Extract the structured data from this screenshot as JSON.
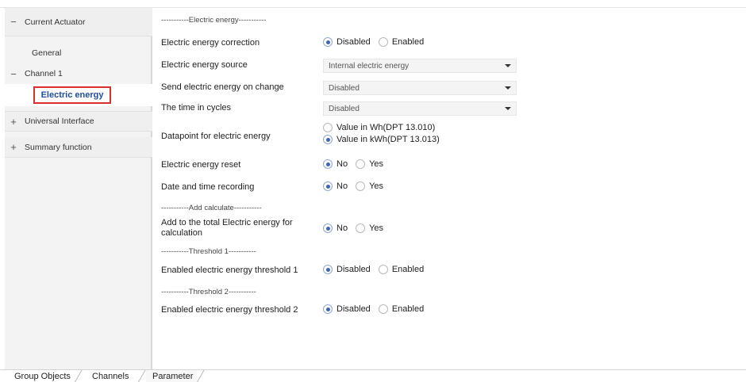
{
  "tree": {
    "items": [
      {
        "sign": "−",
        "label": "Current Actuator"
      },
      {
        "sign": "",
        "label": "General"
      },
      {
        "sign": "−",
        "label": "Channel 1"
      },
      {
        "sign": "",
        "label": "Electric energy"
      },
      {
        "sign": "+",
        "label": "Universal Interface"
      },
      {
        "sign": "+",
        "label": "Summary function"
      }
    ]
  },
  "params": {
    "sep_electric": "-----------Electric energy-----------",
    "correction": {
      "label": "Electric energy correction",
      "options": [
        "Disabled",
        "Enabled"
      ],
      "selected": "Disabled"
    },
    "source": {
      "label": "Electric energy source",
      "value": "Internal electric energy"
    },
    "send_on_change": {
      "label": "Send electric energy on change",
      "value": "Disabled"
    },
    "time_in_cycles": {
      "label": "The time in cycles",
      "value": "Disabled"
    },
    "datapoint": {
      "label": "Datapoint for electric energy",
      "options": [
        "Value in Wh(DPT 13.010)",
        "Value in kWh(DPT 13.013)"
      ],
      "selected": "Value in kWh(DPT 13.013)"
    },
    "reset": {
      "label": "Electric energy reset",
      "options": [
        "No",
        "Yes"
      ],
      "selected": "No"
    },
    "date_time": {
      "label": "Date and time recording",
      "options": [
        "No",
        "Yes"
      ],
      "selected": "No"
    },
    "sep_add": "-----------Add calculate-----------",
    "add_total": {
      "label": "Add to the total Electric energy for calculation",
      "options": [
        "No",
        "Yes"
      ],
      "selected": "No"
    },
    "sep_t1": "-----------Threshold 1-----------",
    "threshold1": {
      "label": "Enabled electric energy threshold 1",
      "options": [
        "Disabled",
        "Enabled"
      ],
      "selected": "Disabled"
    },
    "sep_t2": "-----------Threshold 2-----------",
    "threshold2": {
      "label": "Enabled electric energy threshold 2",
      "options": [
        "Disabled",
        "Enabled"
      ],
      "selected": "Disabled"
    }
  },
  "tabs": [
    "Group Objects",
    "Channels",
    "Parameter"
  ]
}
